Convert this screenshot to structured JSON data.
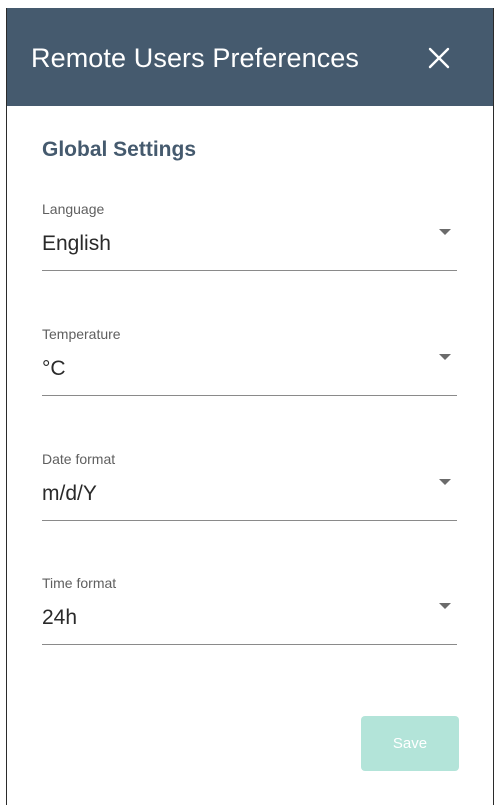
{
  "header": {
    "title": "Remote Users Preferences",
    "close_icon": "close-icon",
    "background_color": "#455a6e"
  },
  "section": {
    "title": "Global Settings"
  },
  "fields": {
    "language": {
      "label": "Language",
      "value": "English",
      "icon": "chevron-down-icon"
    },
    "temperature": {
      "label": "Temperature",
      "value": "°C",
      "icon": "chevron-down-icon"
    },
    "date_format": {
      "label": "Date format",
      "value": "m/d/Y",
      "icon": "chevron-down-icon"
    },
    "time_format": {
      "label": "Time format",
      "value": "24h",
      "icon": "chevron-down-icon"
    }
  },
  "actions": {
    "save_label": "Save",
    "save_color": "#b3e4d9",
    "save_state": "disabled"
  }
}
